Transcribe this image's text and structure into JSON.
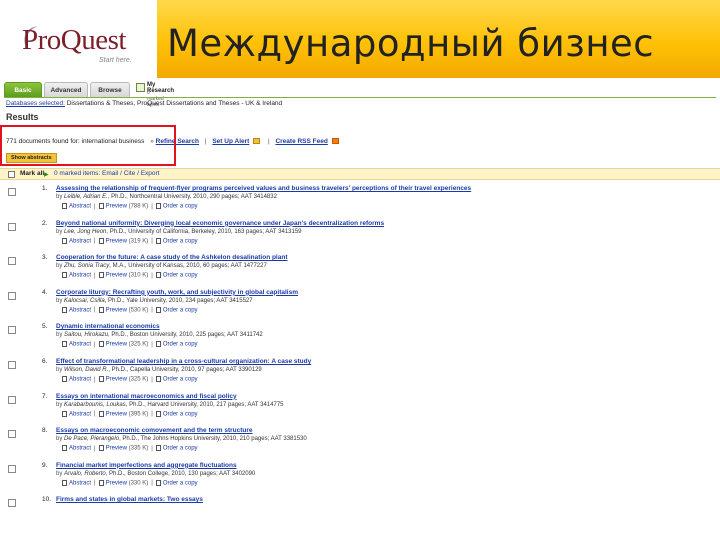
{
  "slide": {
    "title": "Международный бизнес",
    "logo_text": "ProQuest",
    "logo_tagline": "Start here.",
    "colors": {
      "title_bar": "#ffc107",
      "logo": "#7a1f2b"
    }
  },
  "app": {
    "tabs": [
      {
        "label": "Basic",
        "active": true
      },
      {
        "label": "Advanced",
        "active": false
      },
      {
        "label": "Browse",
        "active": false
      }
    ],
    "my_research": {
      "label": "My Research",
      "sub": "0 marked items"
    },
    "database_line": {
      "prefix": "Databases selected:",
      "value": "Dissertations & Theses, ProQuest Dissertations and Theses - UK & Ireland"
    },
    "results_heading": "Results",
    "search_summary": {
      "text": "771 documents found for: international business",
      "refine": "Refine Search",
      "alert": "Set Up Alert",
      "rss": "Create RSS Feed"
    },
    "refine_button": "Show abstracts",
    "marked_bar": {
      "label": "Mark all",
      "count_text": "0 marked items: Email / Cite / Export"
    },
    "results": [
      {
        "num": "1.",
        "title": "Assessing the relationship of frequent-flyer programs perceived values and business travelers' perceptions of their travel experiences",
        "author": "Leible, Adrian E.",
        "meta": ", Ph.D., Northcentral University, 2010, 290 pages; AAT 3414832",
        "links": [
          "Abstract",
          "Preview",
          "(788 K)",
          "Order a copy"
        ]
      },
      {
        "num": "2.",
        "title": "Beyond national uniformity: Diverging local economic governance under Japan's decentralization reforms",
        "author": "Lee, Jong Heon",
        "meta": ", Ph.D., University of California, Berkeley, 2010, 163 pages; AAT 3413159",
        "links": [
          "Abstract",
          "Preview",
          "(319 K)",
          "Order a copy"
        ]
      },
      {
        "num": "3.",
        "title": "Cooperation for the future: A case study of the Ashkelon desalination plant",
        "author": "Zhu, Sonia Tracy",
        "meta": ", M.A., University of Kansas, 2010, 60 pages; AAT 1477227",
        "links": [
          "Abstract",
          "Preview",
          "(310 K)",
          "Order a copy"
        ]
      },
      {
        "num": "4.",
        "title": "Corporate liturgy: Recrafting youth, work, and subjectivity in global capitalism",
        "author": "Kalocsai, Csilla",
        "meta": ", Ph.D., Yale University, 2010, 234 pages; AAT 3415527",
        "links": [
          "Abstract",
          "Preview",
          "(530 K)",
          "Order a copy"
        ]
      },
      {
        "num": "5.",
        "title": "Dynamic international economics",
        "author": "Saitou, Hirokazu",
        "meta": ", Ph.D., Boston University, 2010, 225 pages; AAT 3411742",
        "links": [
          "Abstract",
          "Preview",
          "(325 K)",
          "Order a copy"
        ]
      },
      {
        "num": "6.",
        "title": "Effect of transformational leadership in a cross-cultural organization: A case study",
        "author": "Wilson, David R.",
        "meta": ", Ph.D., Capella University, 2010, 97 pages; AAT 3390129",
        "links": [
          "Abstract",
          "Preview",
          "(325 K)",
          "Order a copy"
        ]
      },
      {
        "num": "7.",
        "title": "Essays on international macroeconomics and fiscal policy",
        "author": "Karabarbounis, Loukas",
        "meta": ", Ph.D., Harvard University, 2010, 217 pages; AAT 3414775",
        "links": [
          "Abstract",
          "Preview",
          "(395 K)",
          "Order a copy"
        ]
      },
      {
        "num": "8.",
        "title": "Essays on macroeconomic comovement and the term structure",
        "author": "De Pace, Pierangelo",
        "meta": ", Ph.D., The Johns Hopkins University, 2010, 210 pages; AAT 3381530",
        "links": [
          "Abstract",
          "Preview",
          "(335 K)",
          "Order a copy"
        ]
      },
      {
        "num": "9.",
        "title": "Financial market imperfections and aggregate fluctuations",
        "author": "Arvalo, Roberto",
        "meta": ", Ph.D., Boston College, 2010, 130 pages; AAT 3402090",
        "links": [
          "Abstract",
          "Preview",
          "(330 K)",
          "Order a copy"
        ]
      },
      {
        "num": "10.",
        "title": "Firms and states in global markets: Two essays",
        "author": "",
        "meta": "",
        "links": []
      }
    ]
  }
}
